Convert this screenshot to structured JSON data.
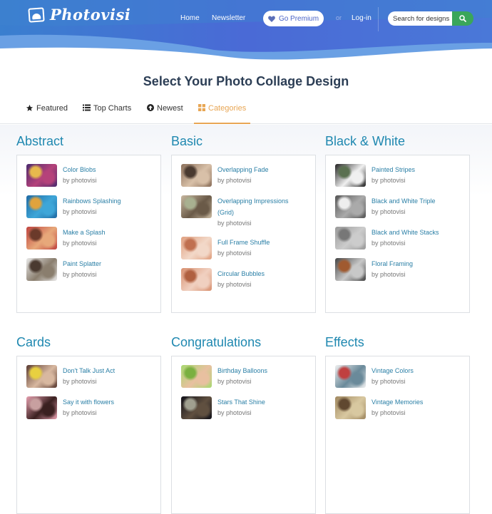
{
  "header": {
    "logo_text": "Photovisi",
    "nav": {
      "home": "Home",
      "newsletter": "Newsletter"
    },
    "premium_label": "Go Premium",
    "or_text": "or",
    "login_label": "Log-in",
    "search_placeholder": "Search for designs"
  },
  "page_title": "Select Your Photo Collage Design",
  "tabs": [
    {
      "label": "Featured",
      "icon": "star-icon"
    },
    {
      "label": "Top Charts",
      "icon": "list-icon"
    },
    {
      "label": "Newest",
      "icon": "arrow-up-circle-icon"
    },
    {
      "label": "Categories",
      "icon": "grid-icon",
      "active": true
    }
  ],
  "colors": {
    "accent_orange": "#e8a654",
    "category_blue": "#1f88b0",
    "link_blue": "#2a7fa6",
    "search_green": "#3aa65a",
    "header_blue": "#4560d0"
  },
  "categories": [
    {
      "title": "Abstract",
      "items": [
        {
          "name": "Color Blobs",
          "by": "by photovisi",
          "thumb": [
            "#4b2a6e",
            "#b5427a",
            "#e7b94d"
          ]
        },
        {
          "name": "Rainbows Splashing",
          "by": "by photovisi",
          "thumb": [
            "#1f6aa3",
            "#3ea6d8",
            "#e0a33d"
          ]
        },
        {
          "name": "Make a Splash",
          "by": "by photovisi",
          "thumb": [
            "#c0433f",
            "#e7a87a",
            "#6b3a2a"
          ]
        },
        {
          "name": "Paint Splatter",
          "by": "by photovisi",
          "thumb": [
            "#e9e9e9",
            "#8a7e6e",
            "#4a3a30"
          ]
        }
      ]
    },
    {
      "title": "Basic",
      "items": [
        {
          "name": "Overlapping Fade",
          "by": "by photovisi",
          "thumb": [
            "#8b6f5a",
            "#d8c0a8",
            "#4a3a30"
          ]
        },
        {
          "name": "Overlapping Impressions (Grid)",
          "by": "by photovisi",
          "thumb": [
            "#c8b8a0",
            "#6a5a48",
            "#a8b090"
          ]
        },
        {
          "name": "Full Frame Shuffle",
          "by": "by photovisi",
          "thumb": [
            "#e0a080",
            "#f2d8c8",
            "#c07050"
          ]
        },
        {
          "name": "Circular Bubbles",
          "by": "by photovisi",
          "thumb": [
            "#d89070",
            "#f0d0c0",
            "#b06040"
          ]
        }
      ]
    },
    {
      "title": "Black & White",
      "items": [
        {
          "name": "Painted Stripes",
          "by": "by photovisi",
          "thumb": [
            "#222222",
            "#f0f0f0",
            "#5a7050"
          ]
        },
        {
          "name": "Black and White Triple",
          "by": "by photovisi",
          "thumb": [
            "#555555",
            "#aaaaaa",
            "#eeeeee"
          ]
        },
        {
          "name": "Black and White Stacks",
          "by": "by photovisi",
          "thumb": [
            "#999999",
            "#cccccc",
            "#777777"
          ]
        },
        {
          "name": "Floral Framing",
          "by": "by photovisi",
          "thumb": [
            "#444444",
            "#c8c8c8",
            "#a05a30"
          ]
        }
      ]
    },
    {
      "title": "Cards",
      "items": [
        {
          "name": "Don't Talk Just Act",
          "by": "by photovisi",
          "thumb": [
            "#5a3a30",
            "#d8b8a0",
            "#e8d040"
          ]
        },
        {
          "name": "Say it with flowers",
          "by": "by photovisi",
          "thumb": [
            "#e8a0b0",
            "#3a2020",
            "#c8a0a0"
          ]
        }
      ]
    },
    {
      "title": "Congratulations",
      "items": [
        {
          "name": "Birthday Balloons",
          "by": "by photovisi",
          "thumb": [
            "#a8d870",
            "#e8c0a0",
            "#7ab040"
          ]
        },
        {
          "name": "Stars That Shine",
          "by": "by photovisi",
          "thumb": [
            "#101018",
            "#605040",
            "#a0a090"
          ]
        }
      ]
    },
    {
      "title": "Effects",
      "items": [
        {
          "name": "Vintage Colors",
          "by": "by photovisi",
          "thumb": [
            "#f0f0f0",
            "#6a8a9a",
            "#c04040"
          ]
        },
        {
          "name": "Vintage Memories",
          "by": "by photovisi",
          "thumb": [
            "#a08860",
            "#d8c8a0",
            "#604830"
          ]
        }
      ]
    }
  ]
}
